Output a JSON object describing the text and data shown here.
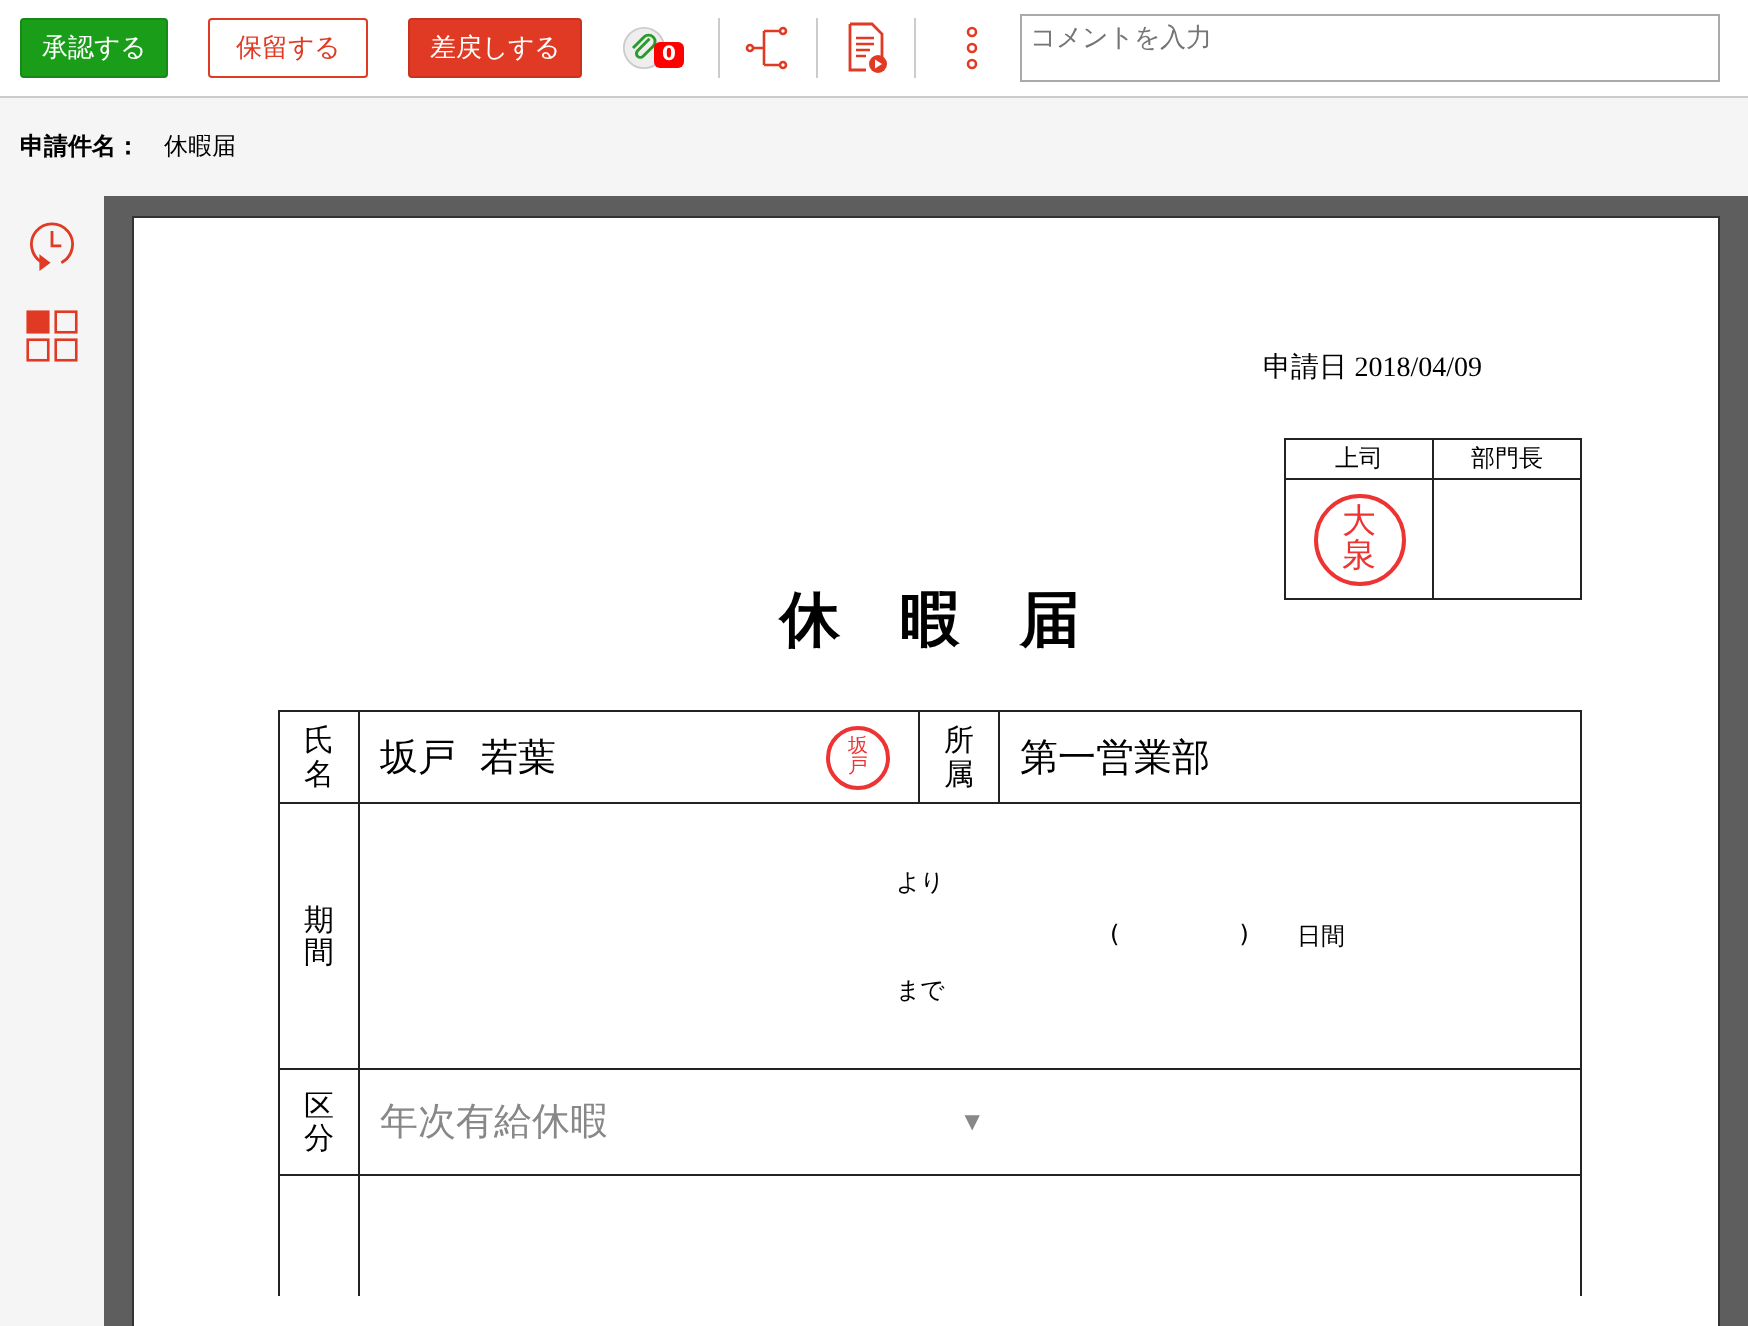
{
  "toolbar": {
    "buttons": [
      {
        "label": "承認する",
        "kind": "approve"
      },
      {
        "label": "保留する",
        "kind": "hold"
      },
      {
        "label": "差戻しする",
        "kind": "reject"
      }
    ],
    "attachment_count": "0",
    "comment": {
      "placeholder": "コメントを入力"
    }
  },
  "subject": {
    "label": "申請件名：",
    "value": "休暇届"
  },
  "document": {
    "date": "申請日 2018/04/09",
    "approvals": [
      {
        "role": "上司",
        "stamp": "大泉"
      },
      {
        "role": "部門長"
      }
    ],
    "title": "休　暇　届",
    "name": {
      "label": "氏名",
      "value": "坂戸  若葉",
      "stamp": "坂戸"
    },
    "department": {
      "label": "所属",
      "value": "第一営業部"
    },
    "period": {
      "label": "期間",
      "from": "より",
      "to": "まで",
      "open": "(",
      "close": ")",
      "days": "日間"
    },
    "category": {
      "label": "区分",
      "placeholder": "年次有給休暇",
      "caret": "▼"
    }
  }
}
